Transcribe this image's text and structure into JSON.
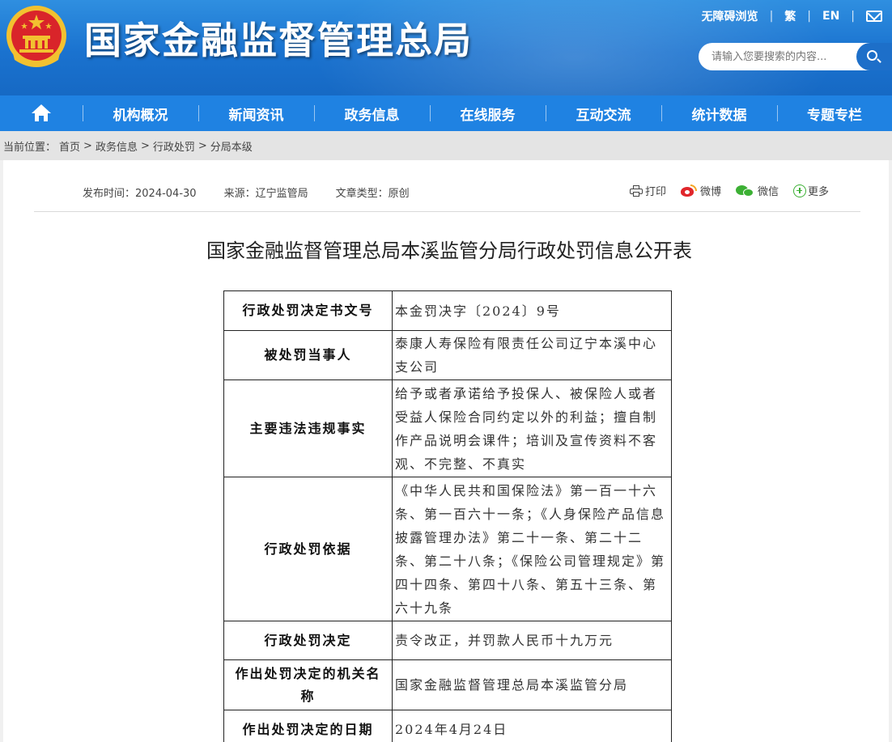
{
  "header": {
    "site_title": "国家金融监督管理总局",
    "top_links": [
      "无障碍浏览",
      "繁",
      "EN"
    ],
    "search_placeholder": "请输入您要搜索的内容..."
  },
  "nav": {
    "items": [
      "机构概况",
      "新闻资讯",
      "政务信息",
      "在线服务",
      "互动交流",
      "统计数据",
      "专题专栏"
    ]
  },
  "breadcrumb": {
    "prefix": "当前位置：",
    "items": [
      "首页",
      "政务信息",
      "行政处罚",
      "分局本级"
    ],
    "separator": ">"
  },
  "article": {
    "publish_time": "发布时间：2024-04-30",
    "source": "来源：辽宁监管局",
    "article_type": "文章类型：原创",
    "share": {
      "print": "打印",
      "weibo": "微博",
      "wechat": "微信",
      "more": "更多"
    },
    "title": "国家金融监督管理总局本溪监管分局行政处罚信息公开表"
  },
  "table": {
    "rows": [
      {
        "label": "行政处罚决定书文号",
        "value": "本金罚决字〔2024〕9号"
      },
      {
        "label": "被处罚当事人",
        "value": "泰康人寿保险有限责任公司辽宁本溪中心支公司"
      },
      {
        "label": "主要违法违规事实",
        "value": "给予或者承诺给予投保人、被保险人或者受益人保险合同约定以外的利益；擅自制作产品说明会课件；培训及宣传资料不客观、不完整、不真实"
      },
      {
        "label": "行政处罚依据",
        "value": "《中华人民共和国保险法》第一百一十六条、第一百六十一条；《人身保险产品信息披露管理办法》第二十一条、第二十二条、第二十八条；《保险公司管理规定》第四十四条、第四十八条、第五十三条、第六十九条"
      },
      {
        "label": "行政处罚决定",
        "value": "责令改正，并罚款人民币十九万元"
      },
      {
        "label": "作出处罚决定的机关名称",
        "value": "国家金融监督管理总局本溪监管分局"
      },
      {
        "label": "作出处罚决定的日期",
        "value": "2024年4月24日"
      }
    ]
  },
  "colors": {
    "header_blue": "#1a72cf",
    "nav_blue": "#1f82e2",
    "breadcrumb_bg": "#e4e4e4",
    "weibo_red": "#e0262b",
    "wechat_green": "#3cb034"
  }
}
